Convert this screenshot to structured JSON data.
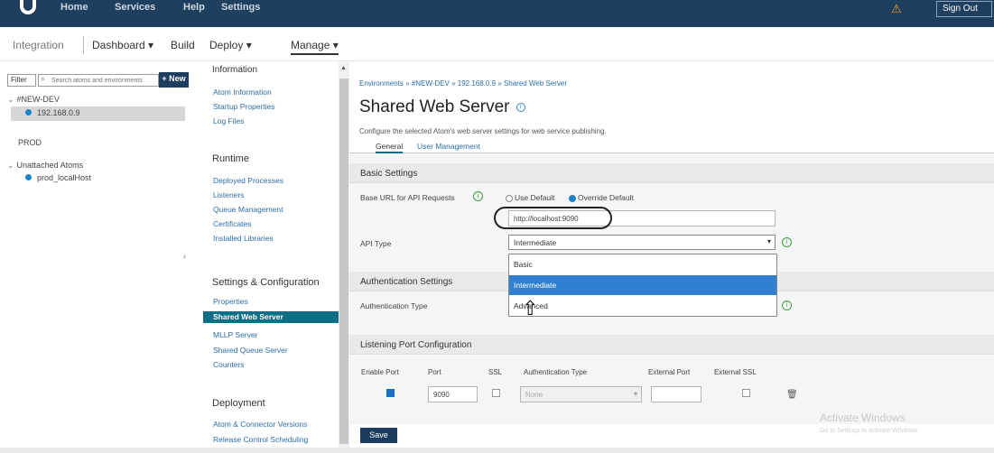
{
  "topbar": {
    "nav": [
      "Home",
      "Services",
      "Help",
      "Settings"
    ],
    "sign_out": "Sign Out"
  },
  "subnav": {
    "integration": "Integration",
    "dashboard": "Dashboard",
    "build": "Build",
    "deploy": "Deploy",
    "manage": "Manage"
  },
  "tree": {
    "filter_label": "Filter",
    "search_placeholder": "Search atoms and environments",
    "new_label": "+ New",
    "items": [
      {
        "label": "#NEW-DEV"
      },
      {
        "label": "192.168.0.9"
      },
      {
        "label": "PROD"
      },
      {
        "label": "Unattached Atoms"
      },
      {
        "label": "prod_localHost"
      }
    ]
  },
  "menu": {
    "information_heading": "Information",
    "information_links": [
      "Atom Information",
      "Startup Properties",
      "Log Files"
    ],
    "runtime_heading": "Runtime",
    "runtime_links": [
      "Deployed Processes",
      "Listeners",
      "Queue Management",
      "Certificates",
      "Installed Libraries"
    ],
    "settings_heading": "Settings & Configuration",
    "settings_links": [
      "Properties",
      "Shared Web Server",
      "MLLP Server",
      "Shared Queue Server",
      "Counters"
    ],
    "deployment_heading": "Deployment",
    "deployment_links": [
      "Atom & Connector Versions",
      "Release Control Scheduling"
    ]
  },
  "main": {
    "breadcrumb": "Environments » #NEW-DEV » 192.168.0.9 » Shared Web Server",
    "title": "Shared Web Server",
    "description": "Configure the selected Atom's web server settings for web service publishing.",
    "tabs": [
      "General",
      "User Management"
    ],
    "basic_settings": "Basic Settings",
    "base_url_label": "Base URL for API Requests",
    "use_default": "Use Default",
    "override_default": "Override Default",
    "base_url_value": "http://localhost:9090",
    "api_type_label": "API Type",
    "api_type_value": "Intermediate",
    "api_type_options": [
      "Basic",
      "Intermediate",
      "Advanced"
    ],
    "auth_settings": "Authentication Settings",
    "auth_type_label": "Authentication Type",
    "listening_port": "Listening Port Configuration",
    "port_headers": [
      "Enable Port",
      "Port",
      "SSL",
      "Authentication Type",
      "External Port",
      "External SSL"
    ],
    "port_value": "9090",
    "auth_type_value": "None",
    "save_label": "Save"
  },
  "watermark": {
    "title": "Activate Windows",
    "subtitle": "Go to Settings to activate Windows."
  },
  "colors": {
    "topbar": "#1f3f5f",
    "selected_menu": "#0d6f86",
    "dropdown_highlight": "#2f80d0",
    "node_dot": "#1b83c5"
  }
}
